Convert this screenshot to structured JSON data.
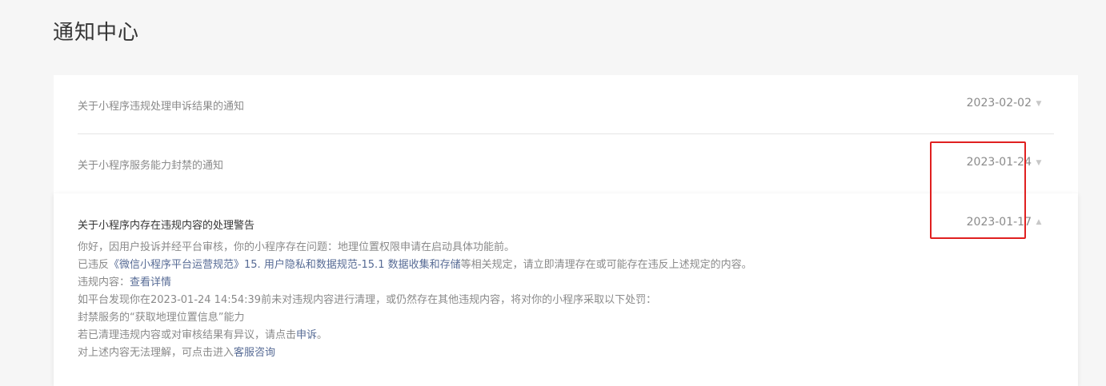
{
  "page": {
    "title": "通知中心"
  },
  "notices": [
    {
      "title": "关于小程序违规处理申诉结果的通知",
      "date": "2023-02-02"
    },
    {
      "title": "关于小程序服务能力封禁的通知",
      "date": "2023-01-24"
    }
  ],
  "expanded": {
    "title": "关于小程序内存在违规内容的处理警告",
    "date": "2023-01-17",
    "line1": "你好，因用户投诉并经平台审核，你的小程序存在问题：地理位置权限申请在启动具体功能前。",
    "line2_prefix": "已违反",
    "line2_link": "《微信小程序平台运营规范》15. 用户隐私和数据规范-15.1 数据收集和存储",
    "line2_suffix": "等相关规定，请立即清理存在或可能存在违反上述规定的内容。",
    "line3_prefix": "违规内容：",
    "line3_link": "查看详情",
    "line4": "如平台发现你在2023-01-24 14:54:39前未对违规内容进行清理，或仍然存在其他违规内容，将对你的小程序采取以下处罚：",
    "line5": "封禁服务的“获取地理位置信息”能力",
    "line6_prefix": "若已清理违规内容或对审核结果有异议，请点击",
    "line6_link": "申诉",
    "line6_suffix": "。",
    "line7_prefix": "对上述内容无法理解，可点击进入",
    "line7_link": "客服咨询"
  },
  "icons": {
    "chevron_down": "▼",
    "chevron_up": "▲"
  },
  "colors": {
    "link": "#576b95",
    "highlight": "#e02020"
  }
}
